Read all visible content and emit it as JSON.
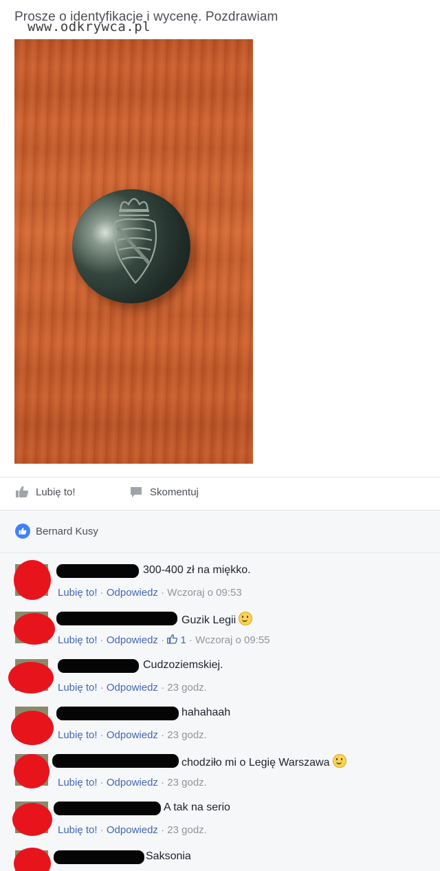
{
  "post": {
    "text": "Prosze o identyfikacje i wycenę. Pozdrawiam",
    "watermark": "www.odkrywca.pl"
  },
  "actions": {
    "like": "Lubię to!",
    "comment": "Skomentuj"
  },
  "likes": {
    "name": "Bernard Kusy"
  },
  "comments": [
    {
      "text": "300-400 zł na miękko.",
      "like": "Lubię to!",
      "reply": "Odpowiedz",
      "time": "Wczoraj o 09:53",
      "likes": ""
    },
    {
      "text": "Guzik Legii",
      "like": "Lubię to!",
      "reply": "Odpowiedz",
      "time": "Wczoraj o 09:55",
      "likes": "1"
    },
    {
      "text": "Cudzoziemskiej.",
      "like": "Lubię to!",
      "reply": "Odpowiedz",
      "time": "23 godz.",
      "likes": ""
    },
    {
      "text": "hahahaah",
      "like": "Lubię to!",
      "reply": "Odpowiedz",
      "time": "23 godz.",
      "likes": ""
    },
    {
      "text": "chodziło mi o Legię Warszawa",
      "like": "Lubię to!",
      "reply": "Odpowiedz",
      "time": "23 godz.",
      "likes": ""
    },
    {
      "text": "A tak na serio",
      "like": "Lubię to!",
      "reply": "Odpowiedz",
      "time": "23 godz.",
      "likes": ""
    },
    {
      "text": "Saksonia",
      "like": "",
      "reply": "",
      "time": "",
      "likes": ""
    }
  ],
  "separator": "·",
  "colors": {
    "link": "#4267b2",
    "meta": "#90949c",
    "redaction": "#e8141c",
    "like_badge": "#4080ff"
  }
}
